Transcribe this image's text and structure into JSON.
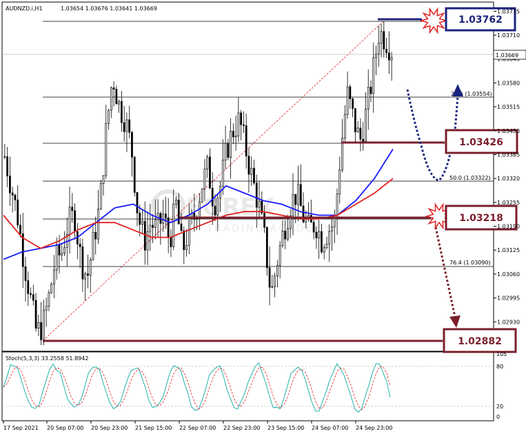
{
  "header": {
    "symbol": "AUDNZD.i,H1",
    "ohlc": "1.03654 1.03676 1.03641 1.03669"
  },
  "stoch_header": "Stoch(5,3,3) 33.2558 51.8942",
  "watermark": {
    "brand": "FOREX",
    "sub": "TRADING ACADEMY"
  },
  "levels": {
    "top": "1.03762",
    "r1": "1.03426",
    "mid": "1.03218",
    "bottom": "1.02882"
  },
  "fib": {
    "f236": "23.6 (1.03554)",
    "f50": "50.0 (1.03322)",
    "f764": "76.4 (1.03090)"
  },
  "price_axis": [
    "1.03775",
    "1.03710",
    "1.03645",
    "1.03580",
    "1.03515",
    "1.03450",
    "1.03385",
    "1.03320",
    "1.03255",
    "1.03190",
    "1.03125",
    "1.03060",
    "1.02995",
    "1.02930"
  ],
  "current_price": "1.03669",
  "stoch_axis": [
    "105",
    "80",
    "20",
    "0"
  ],
  "time_axis": [
    "17 Sep 2021",
    "20 Sep 07:00",
    "20 Sep 23:00",
    "21 Sep 15:00",
    "22 Sep 07:00",
    "22 Sep 23:00",
    "23 Sep 15:00",
    "24 Sep 07:00",
    "24 Sep 23:00"
  ],
  "colors": {
    "bull": "#000000",
    "bear": "#000000",
    "ma_fast": "#1a1aff",
    "ma_slow": "#e02020",
    "level_line": "#7a1f2b",
    "top_box": "#1a237e",
    "stoch_main": "#20b2aa",
    "stoch_signal": "#e02020"
  },
  "chart_data": {
    "type": "candlestick",
    "symbol": "AUDNZD",
    "timeframe": "H1",
    "ylim": [
      1.0285,
      1.038
    ],
    "x": [
      "17 Sep 2021",
      "20 Sep 07:00",
      "20 Sep 23:00",
      "21 Sep 15:00",
      "22 Sep 07:00",
      "22 Sep 23:00",
      "23 Sep 15:00",
      "24 Sep 07:00",
      "24 Sep 23:00"
    ],
    "close_path": [
      1.0338,
      1.033,
      1.0322,
      1.031,
      1.03,
      1.029,
      1.0292,
      1.03,
      1.031,
      1.0312,
      1.032,
      1.0322,
      1.031,
      1.0305,
      1.0315,
      1.0325,
      1.0345,
      1.036,
      1.0352,
      1.0348,
      1.034,
      1.0322,
      1.0315,
      1.032,
      1.0318,
      1.0322,
      1.0315,
      1.0325,
      1.0312,
      1.0318,
      1.0322,
      1.033,
      1.0335,
      1.0325,
      1.033,
      1.034,
      1.0345,
      1.0348,
      1.034,
      1.0332,
      1.0325,
      1.0315,
      1.03,
      1.031,
      1.0318,
      1.0325,
      1.0328,
      1.0322,
      1.0318,
      1.032,
      1.0315,
      1.0318,
      1.032,
      1.034,
      1.0355,
      1.0348,
      1.0342,
      1.035,
      1.036,
      1.0372,
      1.037,
      1.0367
    ],
    "series": [
      {
        "values_note": "fast moving average",
        "values": [
          1.031,
          1.0312,
          1.0313,
          1.0314,
          1.0316,
          1.032,
          1.0324,
          1.0325,
          1.0322,
          1.032,
          1.0322,
          1.0325,
          1.033,
          1.0328,
          1.0326,
          1.0325,
          1.0323,
          1.0322,
          1.0322,
          1.0326,
          1.0332,
          1.034
        ]
      },
      {
        "values_note": "slow moving average",
        "values": [
          1.0322,
          1.0316,
          1.0313,
          1.0315,
          1.0318,
          1.032,
          1.032,
          1.0318,
          1.0316,
          1.0316,
          1.0318,
          1.032,
          1.0322,
          1.0323,
          1.0323,
          1.0322,
          1.0321,
          1.0321,
          1.0322,
          1.0325,
          1.0328,
          1.0332
        ]
      }
    ],
    "levels": [
      1.03762,
      1.03426,
      1.03218,
      1.02882
    ],
    "fib_levels": [
      {
        "label": "23.6",
        "value": 1.03554
      },
      {
        "label": "50.0",
        "value": 1.03322
      },
      {
        "label": "76.4",
        "value": 1.0309
      }
    ],
    "stochastic": {
      "k": 33.2558,
      "d": 51.8942,
      "levels": [
        80,
        20
      ]
    }
  }
}
